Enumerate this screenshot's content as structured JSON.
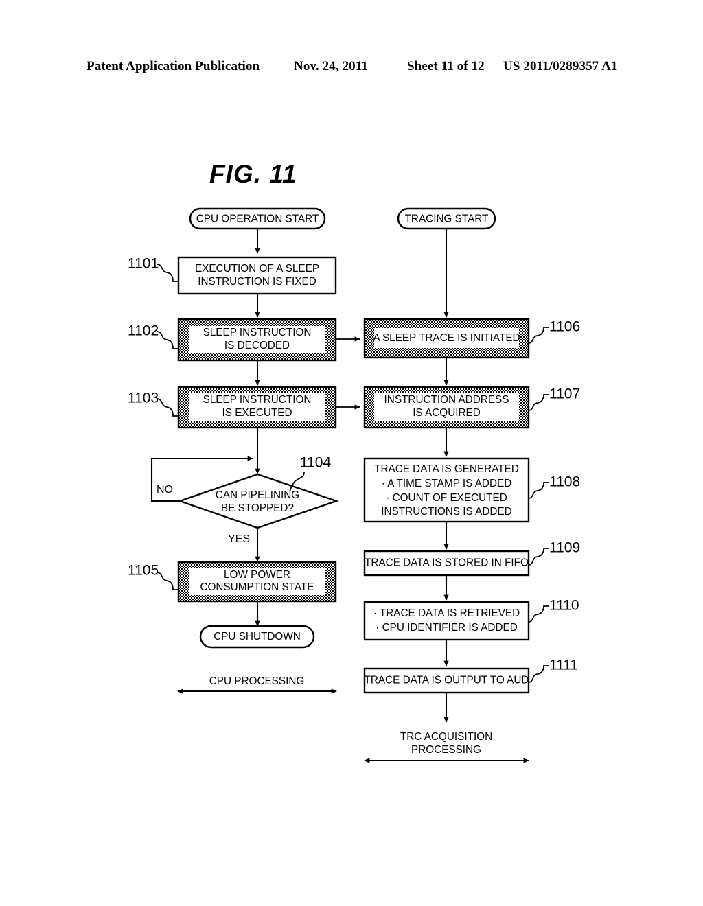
{
  "header": {
    "publication": "Patent Application Publication",
    "date": "Nov. 24, 2011",
    "sheet": "Sheet 11 of 12",
    "doc_number": "US 2011/0289357 A1"
  },
  "figure": {
    "title": "FIG.  11"
  },
  "terminals": {
    "cpu_start": "CPU OPERATION START",
    "tracing_start": "TRACING START",
    "cpu_shutdown": "CPU SHUTDOWN"
  },
  "decision": {
    "ref": "1104",
    "line1": "CAN PIPELINING",
    "line2": "BE STOPPED?",
    "branch_no": "NO",
    "branch_yes": "YES"
  },
  "left_steps": [
    {
      "ref": "1101",
      "shaded": false,
      "lines": [
        "EXECUTION OF A SLEEP",
        "INSTRUCTION IS FIXED"
      ]
    },
    {
      "ref": "1102",
      "shaded": true,
      "lines": [
        "SLEEP INSTRUCTION",
        "IS DECODED"
      ]
    },
    {
      "ref": "1103",
      "shaded": true,
      "lines": [
        "SLEEP INSTRUCTION",
        "IS EXECUTED"
      ]
    },
    {
      "ref": "1105",
      "shaded": true,
      "lines": [
        "LOW POWER",
        "CONSUMPTION STATE"
      ]
    }
  ],
  "right_steps": [
    {
      "ref": "1106",
      "shaded": true,
      "lines": [
        "A SLEEP TRACE IS INITIATED"
      ]
    },
    {
      "ref": "1107",
      "shaded": true,
      "lines": [
        "INSTRUCTION ADDRESS",
        "IS ACQUIRED"
      ]
    },
    {
      "ref": "1108",
      "shaded": false,
      "lines": [
        "TRACE DATA IS GENERATED",
        "· A TIME STAMP IS ADDED",
        "· COUNT OF EXECUTED",
        "INSTRUCTIONS IS ADDED"
      ]
    },
    {
      "ref": "1109",
      "shaded": false,
      "lines": [
        "TRACE DATA IS STORED IN FIFO"
      ]
    },
    {
      "ref": "1110",
      "shaded": false,
      "lines": [
        "· TRACE DATA IS RETRIEVED",
        "· CPU IDENTIFIER IS ADDED"
      ]
    },
    {
      "ref": "1111",
      "shaded": false,
      "lines": [
        "TRACE DATA IS OUTPUT TO AUD"
      ]
    }
  ],
  "footers": {
    "cpu_processing": "CPU PROCESSING",
    "trc_line1": "TRC ACQUISITION",
    "trc_line2": "PROCESSING"
  },
  "colors": {
    "ink": "#000000",
    "paper": "#ffffff",
    "shade": "#8a8a8a"
  }
}
